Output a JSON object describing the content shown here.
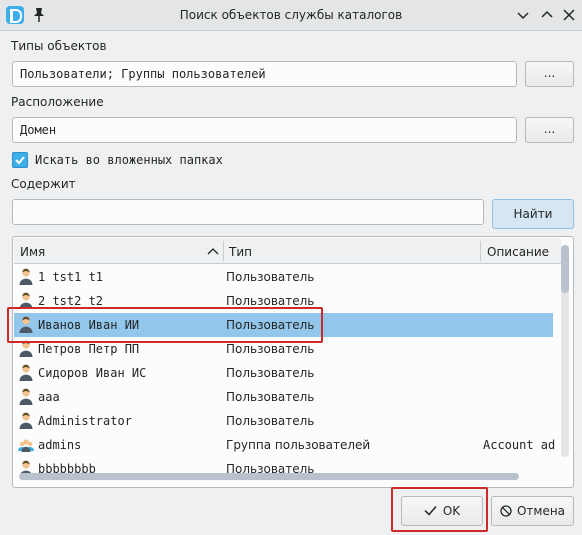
{
  "window": {
    "title": "Поиск объектов службы каталогов",
    "app_icon": "app-logo-icon",
    "pin_icon": "pin-icon",
    "buttons": [
      "chevron-down-icon",
      "chevron-up-icon",
      "close-icon"
    ]
  },
  "object_types": {
    "label": "Типы объектов",
    "value": "Пользователи; Группы пользователей",
    "browse_label": "..."
  },
  "location": {
    "label": "Расположение",
    "value": "Домен",
    "browse_label": "..."
  },
  "subfolders": {
    "label": "Искать во вложенных папках",
    "checked": true
  },
  "contains": {
    "label": "Содержит",
    "value": "",
    "find_label": "Найти"
  },
  "results": {
    "columns": [
      "Имя",
      "Тип",
      "Описание"
    ],
    "sort_icon": "sort-up-icon",
    "rows": [
      {
        "name": "1 tst1 t1",
        "type": "Пользователь",
        "description": "",
        "icon": "user-icon"
      },
      {
        "name": "2 tst2 t2",
        "type": "Пользователь",
        "description": "",
        "icon": "user-icon"
      },
      {
        "name": "Иванов Иван ИИ",
        "type": "Пользователь",
        "description": "",
        "icon": "user-icon",
        "selected": true
      },
      {
        "name": "Петров Петр ПП",
        "type": "Пользователь",
        "description": "",
        "icon": "user-icon"
      },
      {
        "name": "Сидоров Иван ИС",
        "type": "Пользователь",
        "description": "",
        "icon": "user-icon"
      },
      {
        "name": "aaa",
        "type": "Пользователь",
        "description": "",
        "icon": "user-icon"
      },
      {
        "name": "Administrator",
        "type": "Пользователь",
        "description": "",
        "icon": "user-icon"
      },
      {
        "name": "admins",
        "type": "Группа пользователей",
        "description": "Account ad",
        "icon": "group-icon"
      },
      {
        "name": "bbbbbbbb",
        "type": "Пользователь",
        "description": "",
        "icon": "user-icon"
      }
    ]
  },
  "footer": {
    "ok_label": "OK",
    "ok_icon": "check-icon",
    "cancel_label": "Отмена",
    "cancel_icon": "cancel-icon"
  },
  "colors": {
    "accent": "#3daee9",
    "selection": "#93c6eb",
    "highlight": "#cf2a2a",
    "background": "#eff0f1"
  }
}
